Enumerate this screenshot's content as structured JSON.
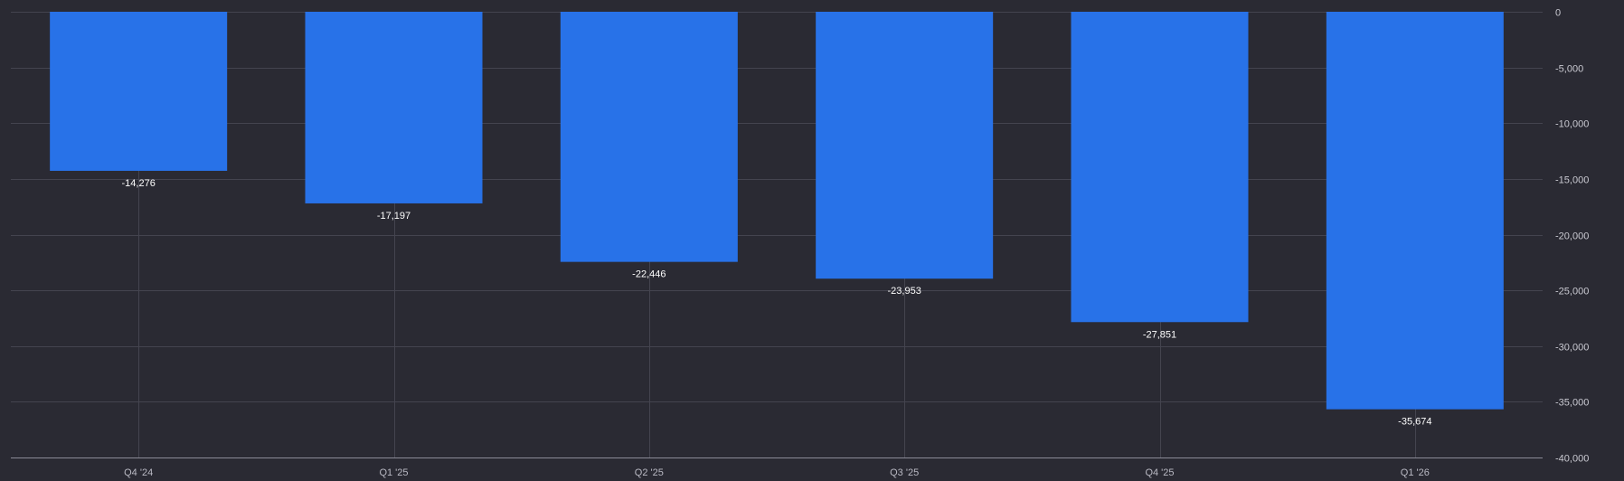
{
  "chart_data": {
    "type": "bar",
    "categories": [
      "Q4 '24",
      "Q1 '25",
      "Q2 '25",
      "Q3 '25",
      "Q4 '25",
      "Q1 '26"
    ],
    "values": [
      -14276,
      -17197,
      -22446,
      -23953,
      -27851,
      -35674
    ],
    "value_labels": [
      "-14,276",
      "-17,197",
      "-22,446",
      "-23,953",
      "-27,851",
      "-35,674"
    ],
    "y_ticks": [
      0,
      -5000,
      -10000,
      -15000,
      -20000,
      -25000,
      -30000,
      -35000,
      -40000
    ],
    "y_tick_labels": [
      "0",
      "-5,000",
      "-10,000",
      "-15,000",
      "-20,000",
      "-25,000",
      "-30,000",
      "-35,000",
      "-40,000"
    ],
    "ylim": [
      -40000,
      0
    ],
    "y_axis_side": "right",
    "grid": true,
    "title": "",
    "xlabel": "",
    "ylabel": "",
    "colors": {
      "background": "#2a2a33",
      "bar": "#2872e8"
    }
  }
}
